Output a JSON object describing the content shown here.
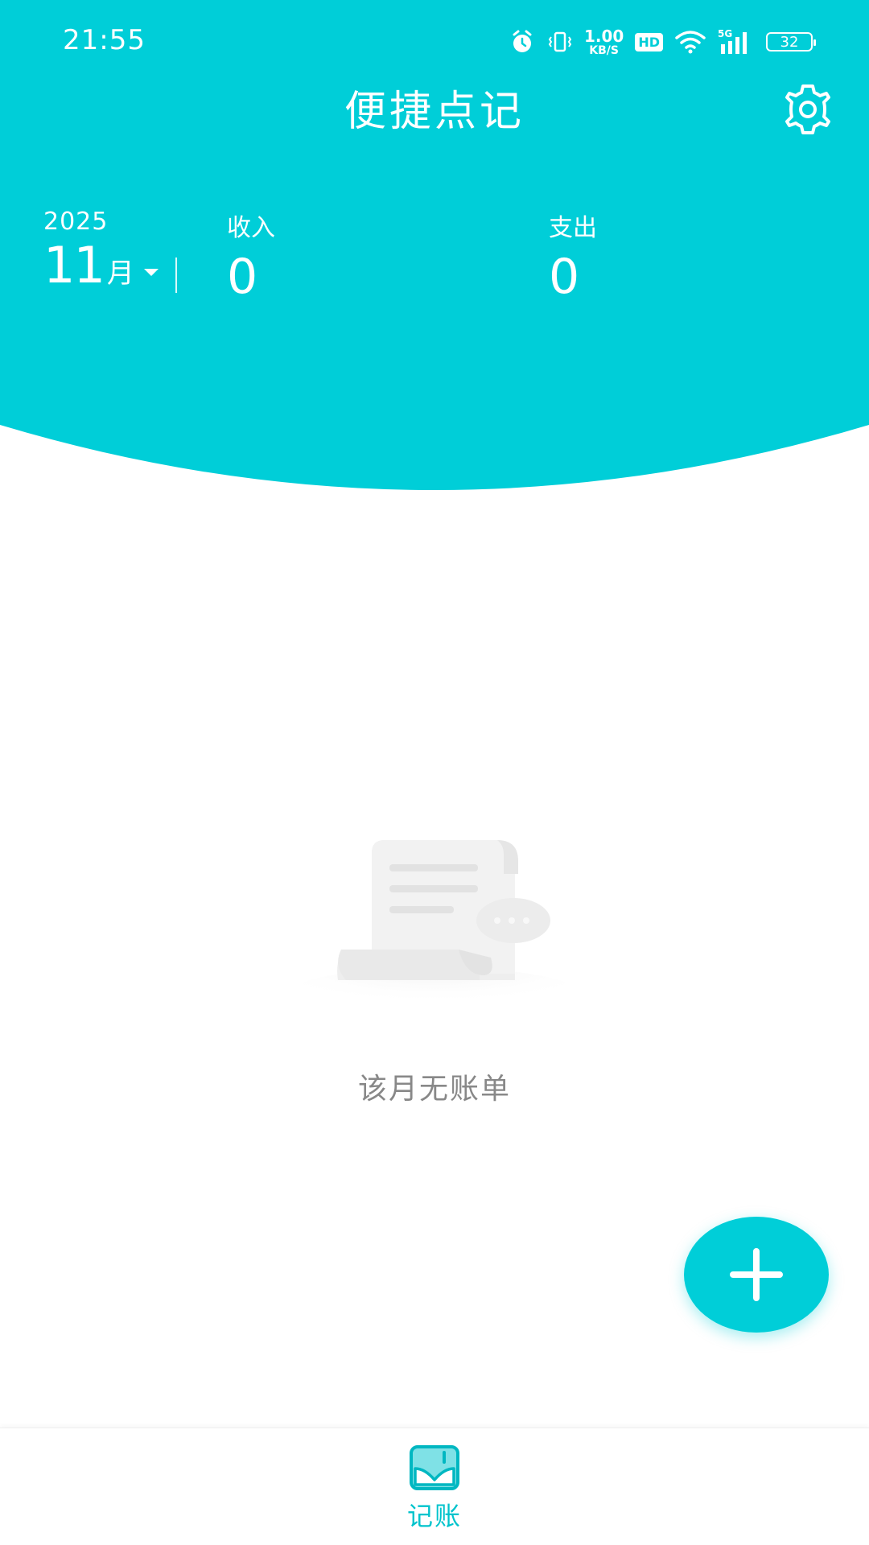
{
  "colors": {
    "accent": "#00CED8",
    "text_on_accent": "#FFFFFF",
    "empty_text": "#888888",
    "tab_active": "#00C3CC"
  },
  "status_bar": {
    "time": "21:55",
    "net_speed_value": "1.00",
    "net_speed_unit": "KB/S",
    "hd_badge": "HD",
    "network": "5G",
    "battery": "32",
    "icons": [
      "alarm-icon",
      "vibrate-icon",
      "wifi-icon",
      "signal-icon",
      "battery-icon"
    ]
  },
  "header": {
    "title": "便捷点记",
    "settings_icon": "gear-icon"
  },
  "summary": {
    "year": "2025",
    "month_num": "11",
    "month_unit": "月",
    "income_label": "收入",
    "income_value": "0",
    "expense_label": "支出",
    "expense_value": "0"
  },
  "empty_state": {
    "illustration": "receipt-icon",
    "message": "该月无账单"
  },
  "fab": {
    "icon": "plus-icon"
  },
  "tabbar": {
    "items": [
      {
        "label": "记账",
        "icon": "ledger-icon",
        "active": true
      }
    ]
  }
}
